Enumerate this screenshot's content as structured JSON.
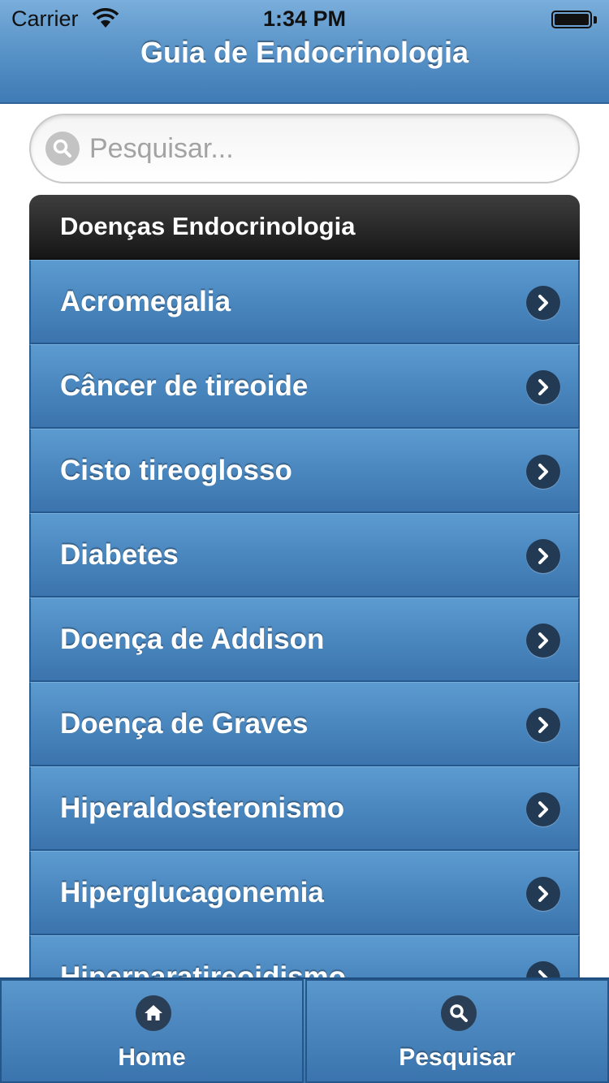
{
  "status_bar": {
    "carrier": "Carrier",
    "time": "1:34 PM"
  },
  "header": {
    "title": "Guia de Endocrinologia"
  },
  "search": {
    "placeholder": "Pesquisar...",
    "value": "",
    "icon": "search-icon"
  },
  "list": {
    "header": "Doenças Endocrinologia",
    "items": [
      {
        "label": "Acromegalia"
      },
      {
        "label": "Câncer de tireoide"
      },
      {
        "label": "Cisto tireoglosso"
      },
      {
        "label": "Diabetes"
      },
      {
        "label": "Doença de Addison"
      },
      {
        "label": "Doença de Graves"
      },
      {
        "label": "Hiperaldosteronismo"
      },
      {
        "label": "Hiperglucagonemia"
      },
      {
        "label": "Hiperparatireoidismo"
      }
    ],
    "item_icon": "chevron-right-icon"
  },
  "tab_bar": {
    "tabs": [
      {
        "label": "Home",
        "icon": "home-icon"
      },
      {
        "label": "Pesquisar",
        "icon": "search-icon"
      }
    ]
  },
  "colors": {
    "header_blue": "#5b95c9",
    "list_item_blue": "#4a87bf",
    "list_header_dark": "#1f1f1f",
    "icon_circle": "#233a55"
  }
}
